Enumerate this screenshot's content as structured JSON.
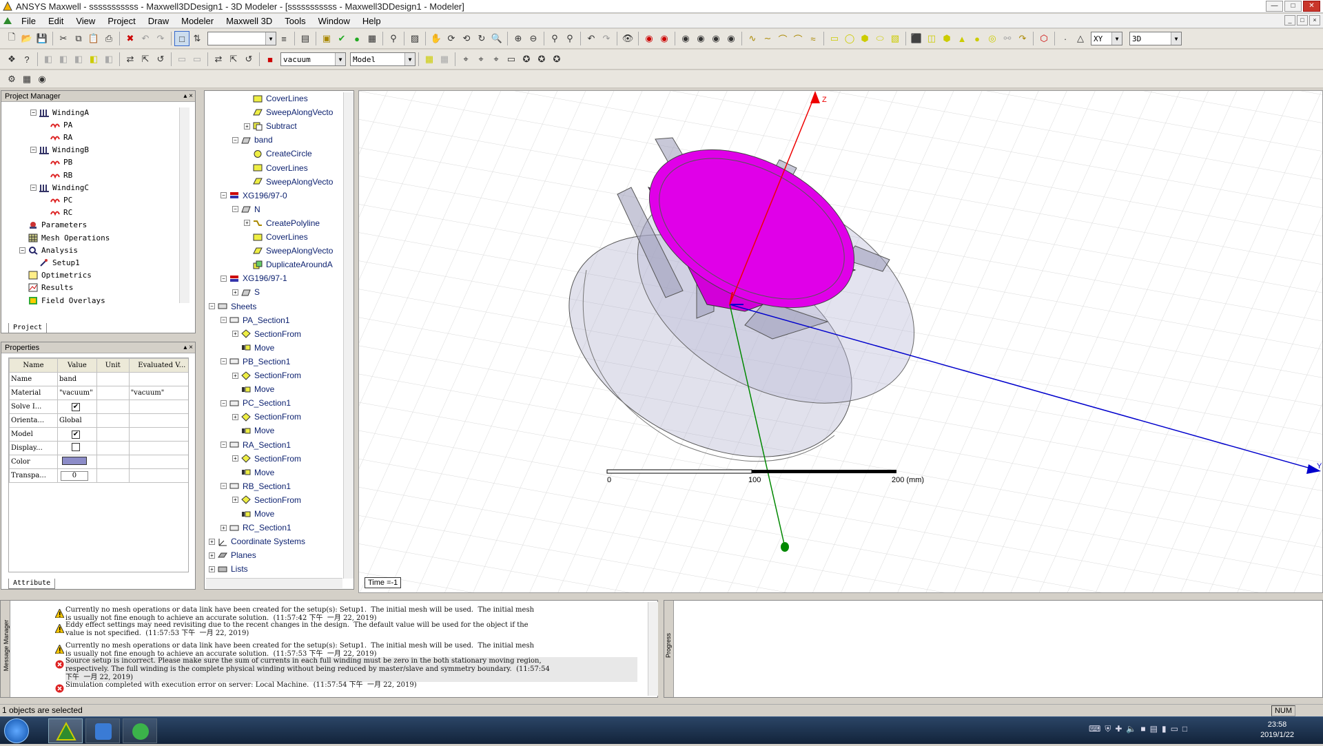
{
  "window": {
    "title": "ANSYS Maxwell - sssssssssss - Maxwell3DDesign1 - 3D Modeler - [sssssssssss - Maxwell3DDesign1 - Modeler]"
  },
  "menu": [
    "File",
    "Edit",
    "View",
    "Project",
    "Draw",
    "Modeler",
    "Maxwell 3D",
    "Tools",
    "Window",
    "Help"
  ],
  "toolbar": {
    "material": "vacuum",
    "model": "Model",
    "plane": "XY",
    "view": "3D"
  },
  "project_manager": {
    "title": "Project Manager",
    "tab": "Project",
    "items": [
      {
        "label": "WindingA",
        "level": 2,
        "exp": "-",
        "icon": "winding-icon"
      },
      {
        "label": "PA",
        "level": 3,
        "exp": "",
        "icon": "coil-icon"
      },
      {
        "label": "RA",
        "level": 3,
        "exp": "",
        "icon": "coil-icon"
      },
      {
        "label": "WindingB",
        "level": 2,
        "exp": "-",
        "icon": "winding-icon"
      },
      {
        "label": "PB",
        "level": 3,
        "exp": "",
        "icon": "coil-icon"
      },
      {
        "label": "RB",
        "level": 3,
        "exp": "",
        "icon": "coil-icon"
      },
      {
        "label": "WindingC",
        "level": 2,
        "exp": "-",
        "icon": "winding-icon"
      },
      {
        "label": "PC",
        "level": 3,
        "exp": "",
        "icon": "coil-icon"
      },
      {
        "label": "RC",
        "level": 3,
        "exp": "",
        "icon": "coil-icon"
      },
      {
        "label": "Parameters",
        "level": 1,
        "exp": "",
        "icon": "parameters-icon"
      },
      {
        "label": "Mesh Operations",
        "level": 1,
        "exp": "",
        "icon": "mesh-icon"
      },
      {
        "label": "Analysis",
        "level": 1,
        "exp": "-",
        "icon": "analysis-icon"
      },
      {
        "label": "Setup1",
        "level": 2,
        "exp": "",
        "icon": "setup-icon"
      },
      {
        "label": "Optimetrics",
        "level": 1,
        "exp": "",
        "icon": "optimetrics-icon"
      },
      {
        "label": "Results",
        "level": 1,
        "exp": "",
        "icon": "results-icon"
      },
      {
        "label": "Field Overlays",
        "level": 1,
        "exp": "",
        "icon": "field-overlays-icon"
      }
    ]
  },
  "properties": {
    "title": "Properties",
    "tab": "Attribute",
    "headers": [
      "Name",
      "Value",
      "Unit",
      "Evaluated V..."
    ],
    "rows": [
      {
        "name": "Name",
        "value": "band",
        "unit": "",
        "eval": "",
        "kind": "text"
      },
      {
        "name": "Material",
        "value": "\"vacuum\"",
        "unit": "",
        "eval": "\"vacuum\"",
        "kind": "text"
      },
      {
        "name": "Solve I...",
        "value": "checked",
        "unit": "",
        "eval": "",
        "kind": "check"
      },
      {
        "name": "Orienta...",
        "value": "Global",
        "unit": "",
        "eval": "",
        "kind": "text"
      },
      {
        "name": "Model",
        "value": "checked",
        "unit": "",
        "eval": "",
        "kind": "check"
      },
      {
        "name": "Display...",
        "value": "unchecked",
        "unit": "",
        "eval": "",
        "kind": "check"
      },
      {
        "name": "Color",
        "value": "",
        "unit": "",
        "eval": "",
        "kind": "color"
      },
      {
        "name": "Transpa...",
        "value": "0",
        "unit": "",
        "eval": "",
        "kind": "box"
      }
    ],
    "color_swatch": "#8c8cc8"
  },
  "history_tree": {
    "items": [
      {
        "label": "CoverLines",
        "level": 3,
        "exp": "",
        "icon": "cover-lines-icon"
      },
      {
        "label": "SweepAlongVecto",
        "level": 3,
        "exp": "",
        "icon": "sweep-icon"
      },
      {
        "label": "Subtract",
        "level": 3,
        "exp": "+",
        "icon": "subtract-icon"
      },
      {
        "label": "band",
        "level": 2,
        "exp": "-",
        "icon": "solid-icon"
      },
      {
        "label": "CreateCircle",
        "level": 3,
        "exp": "",
        "icon": "circle-icon"
      },
      {
        "label": "CoverLines",
        "level": 3,
        "exp": "",
        "icon": "cover-lines-icon"
      },
      {
        "label": "SweepAlongVecto",
        "level": 3,
        "exp": "",
        "icon": "sweep-icon"
      },
      {
        "label": "XG196/97-0",
        "level": 1,
        "exp": "-",
        "icon": "material-icon"
      },
      {
        "label": "N",
        "level": 2,
        "exp": "-",
        "icon": "solid-icon"
      },
      {
        "label": "CreatePolyline",
        "level": 3,
        "exp": "+",
        "icon": "polyline-icon"
      },
      {
        "label": "CoverLines",
        "level": 3,
        "exp": "",
        "icon": "cover-lines-icon"
      },
      {
        "label": "SweepAlongVecto",
        "level": 3,
        "exp": "",
        "icon": "sweep-icon"
      },
      {
        "label": "DuplicateAroundA",
        "level": 3,
        "exp": "",
        "icon": "duplicate-icon"
      },
      {
        "label": "XG196/97-1",
        "level": 1,
        "exp": "-",
        "icon": "material-icon"
      },
      {
        "label": "S",
        "level": 2,
        "exp": "+",
        "icon": "solid-icon"
      },
      {
        "label": "Sheets",
        "level": 0,
        "exp": "-",
        "icon": "sheets-icon"
      },
      {
        "label": "PA_Section1",
        "level": 1,
        "exp": "-",
        "icon": "sheet-icon"
      },
      {
        "label": "SectionFrom",
        "level": 2,
        "exp": "+",
        "icon": "section-icon"
      },
      {
        "label": "Move",
        "level": 2,
        "exp": "",
        "icon": "move-icon"
      },
      {
        "label": "PB_Section1",
        "level": 1,
        "exp": "-",
        "icon": "sheet-icon"
      },
      {
        "label": "SectionFrom",
        "level": 2,
        "exp": "+",
        "icon": "section-icon"
      },
      {
        "label": "Move",
        "level": 2,
        "exp": "",
        "icon": "move-icon"
      },
      {
        "label": "PC_Section1",
        "level": 1,
        "exp": "-",
        "icon": "sheet-icon"
      },
      {
        "label": "SectionFrom",
        "level": 2,
        "exp": "+",
        "icon": "section-icon"
      },
      {
        "label": "Move",
        "level": 2,
        "exp": "",
        "icon": "move-icon"
      },
      {
        "label": "RA_Section1",
        "level": 1,
        "exp": "-",
        "icon": "sheet-icon"
      },
      {
        "label": "SectionFrom",
        "level": 2,
        "exp": "+",
        "icon": "section-icon"
      },
      {
        "label": "Move",
        "level": 2,
        "exp": "",
        "icon": "move-icon"
      },
      {
        "label": "RB_Section1",
        "level": 1,
        "exp": "-",
        "icon": "sheet-icon"
      },
      {
        "label": "SectionFrom",
        "level": 2,
        "exp": "+",
        "icon": "section-icon"
      },
      {
        "label": "Move",
        "level": 2,
        "exp": "",
        "icon": "move-icon"
      },
      {
        "label": "RC_Section1",
        "level": 1,
        "exp": "+",
        "icon": "sheet-icon"
      },
      {
        "label": "Coordinate Systems",
        "level": 0,
        "exp": "+",
        "icon": "coordinate-systems-icon"
      },
      {
        "label": "Planes",
        "level": 0,
        "exp": "+",
        "icon": "planes-icon"
      },
      {
        "label": "Lists",
        "level": 0,
        "exp": "+",
        "icon": "lists-icon"
      }
    ]
  },
  "viewport": {
    "time_label": "Time =-1",
    "axis_labels": {
      "z": "Z",
      "y": "Y"
    },
    "scale": {
      "ticks": [
        "0",
        "100",
        "200 (mm)"
      ]
    }
  },
  "messages": {
    "panel_label": "Message Manager",
    "lines": [
      {
        "type": "warning",
        "text": "Currently no mesh operations or data link have been created for the setup(s): Setup1.  The initial mesh will be used.  The initial mesh\nis usually not fine enough to achieve an accurate solution.  (11:57:42 下午  一月 22, 2019)"
      },
      {
        "type": "warning",
        "text": "Eddy effect settings may need revisiting due to the recent changes in the design.  The default value will be used for the object if the\nvalue is not specified.  (11:57:53 下午  一月 22, 2019)"
      },
      {
        "type": "warning",
        "text": "Currently no mesh operations or data link have been created for the setup(s): Setup1.  The initial mesh will be used.  The initial mesh\nis usually not fine enough to achieve an accurate solution.  (11:57:53 下午  一月 22, 2019)"
      },
      {
        "type": "error",
        "text": "Source setup is incorrect. Please make sure the sum of currents in each full winding must be zero in the both stationary moving region,\nrespectively. The full winding is the complete physical winding without being reduced by master/slave and symmetry boundary.  (11:57:54\n下午  一月 22, 2019)"
      },
      {
        "type": "error",
        "text": "Simulation completed with execution error on server: Local Machine.  (11:57:54 下午  一月 22, 2019)"
      }
    ]
  },
  "progress": {
    "panel_label": "Progress"
  },
  "statusbar": {
    "text": "1 objects are selected",
    "num": "NUM"
  },
  "taskbar": {
    "time": "23:58",
    "date": "2019/1/22"
  }
}
